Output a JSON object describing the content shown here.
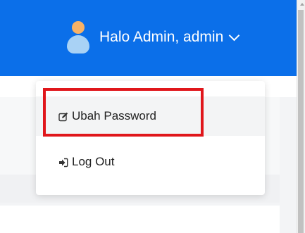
{
  "header": {
    "user_greeting": "Halo Admin, admin",
    "avatar_icon": "user-avatar-icon",
    "dropdown_icon": "chevron-down-icon"
  },
  "dropdown": {
    "items": [
      {
        "label": "Ubah Password",
        "icon": "edit-icon"
      },
      {
        "label": "Log Out",
        "icon": "sign-out-icon"
      }
    ]
  },
  "highlight": {
    "target": "Ubah Password",
    "color": "#e0161b"
  },
  "colors": {
    "header_bg": "#0b6fe9",
    "text_on_header": "#ffffff"
  }
}
